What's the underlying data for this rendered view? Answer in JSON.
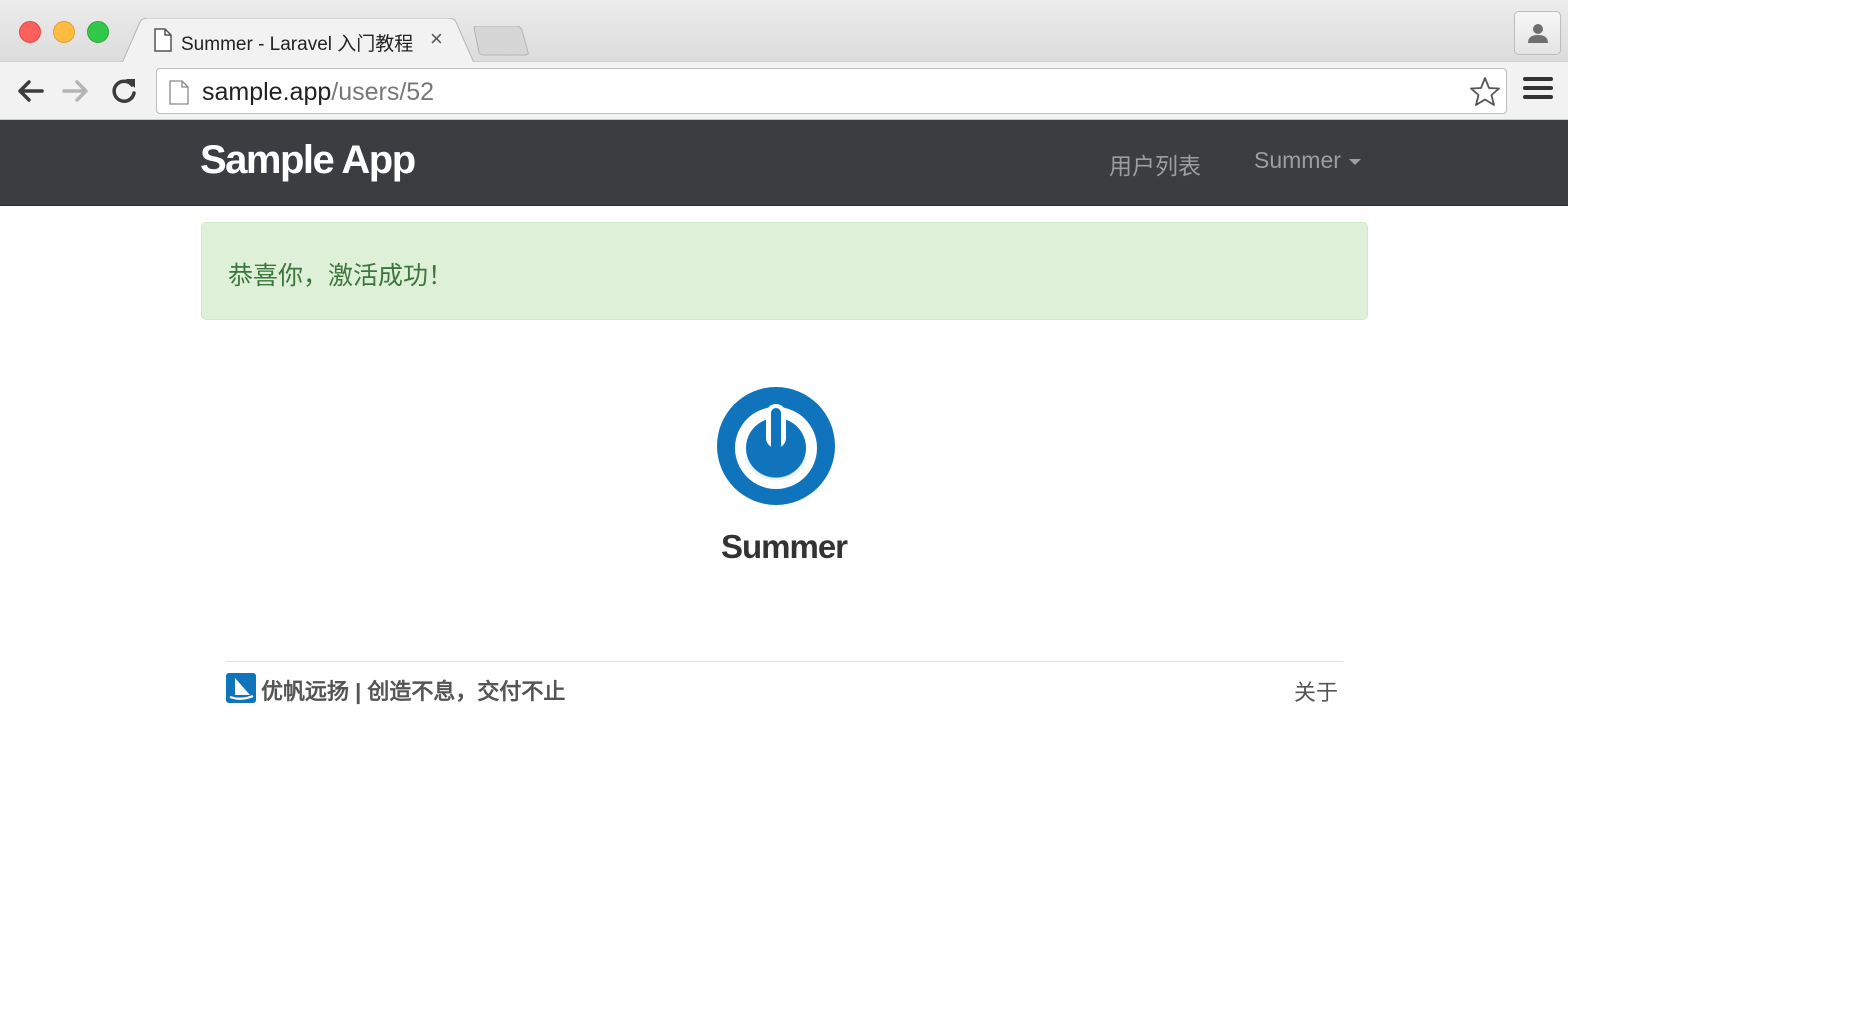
{
  "browser": {
    "tab_title": "Summer - Laravel 入门教程",
    "tab_close": "×",
    "url_host": "sample.app",
    "url_path": "/users/52"
  },
  "navbar": {
    "brand": "Sample App",
    "links": [
      {
        "label": "用户列表"
      },
      {
        "label": "Summer"
      }
    ]
  },
  "alert": {
    "message": "恭喜你，激活成功！",
    "color": "#3c763d",
    "background": "#dff0d8"
  },
  "profile": {
    "name": "Summer",
    "avatar_icon": "power-icon",
    "avatar_color": "#0f74bc"
  },
  "footer": {
    "text": "优帆远扬 | 创造不息，交付不止",
    "about": "关于",
    "logo_icon": "sailboat-logo-icon"
  },
  "colors": {
    "navbar_bg": "#3c3d41",
    "brand": "#ffffff"
  }
}
